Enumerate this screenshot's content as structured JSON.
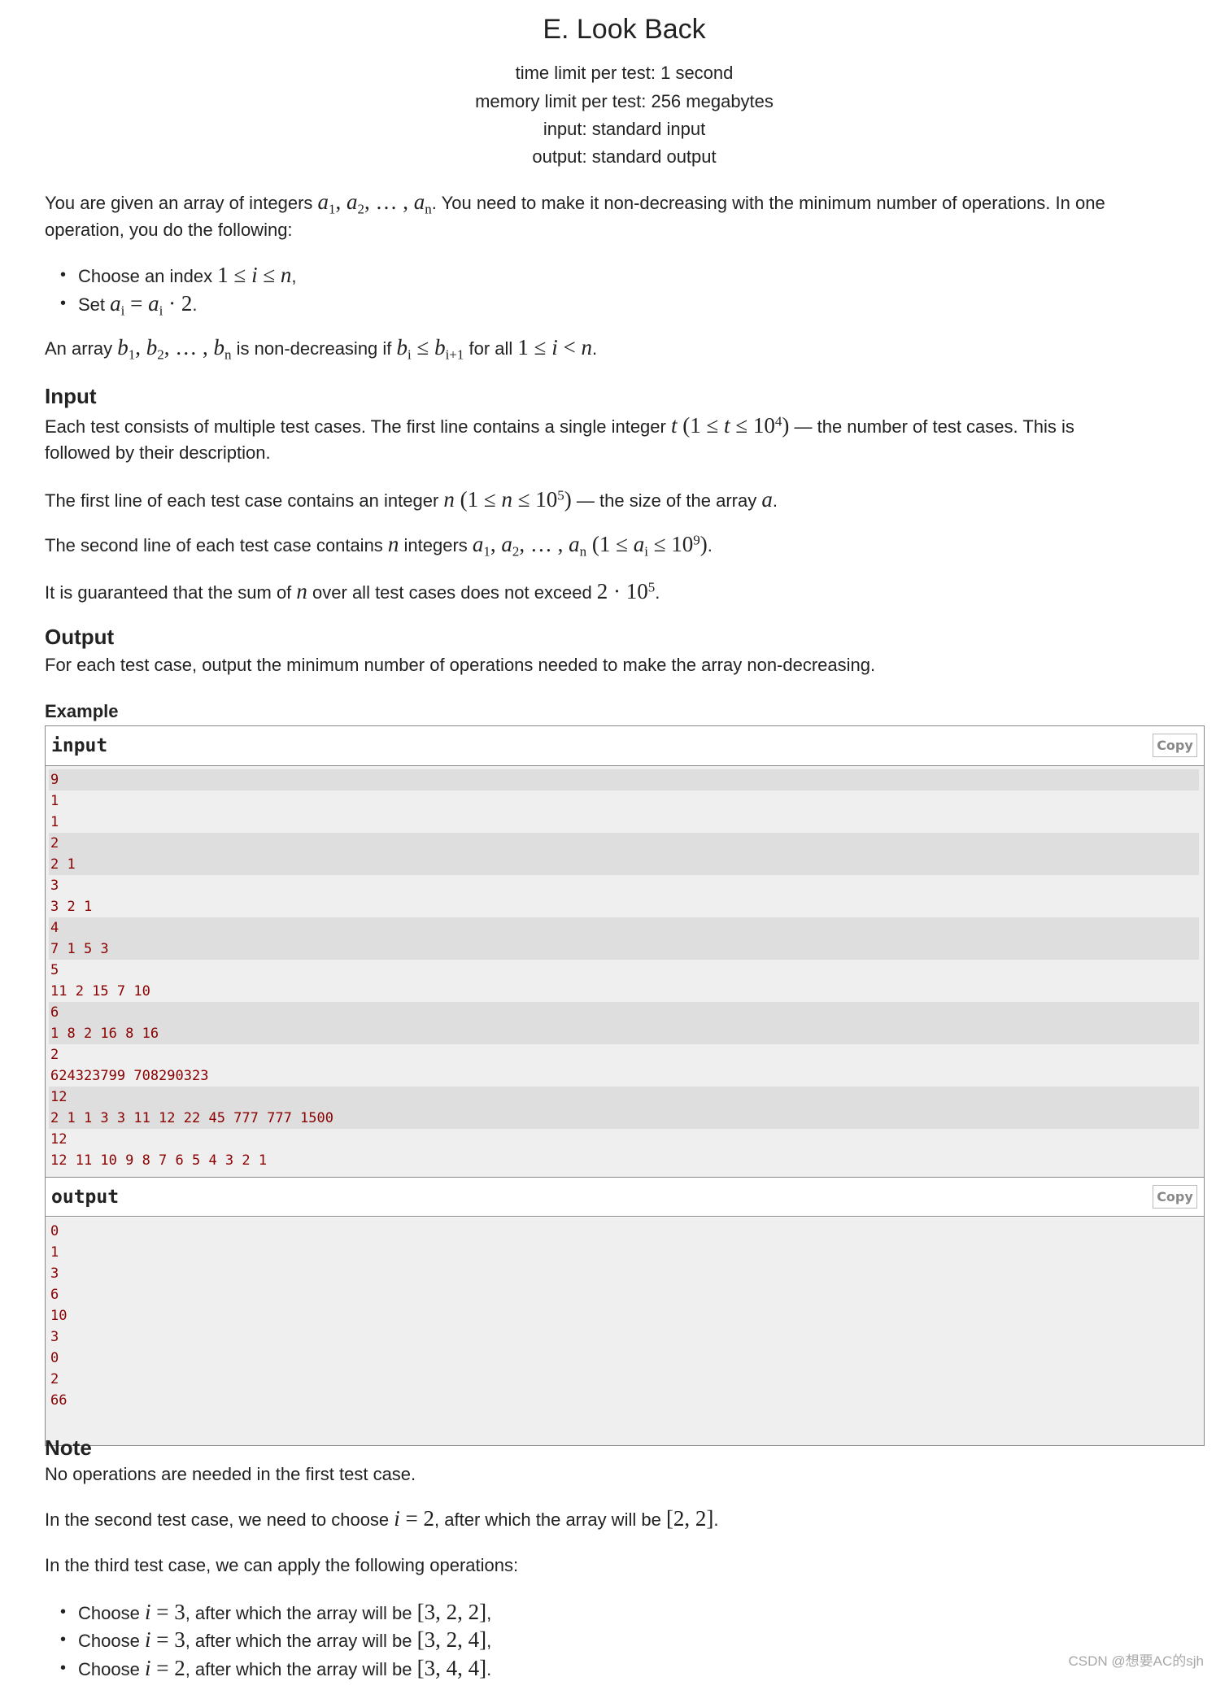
{
  "header": {
    "title": "E. Look Back",
    "time_limit": "time limit per test: 1 second",
    "memory_limit": "memory limit per test: 256 megabytes",
    "input_spec": "input: standard input",
    "output_spec": "output: standard output"
  },
  "statement": {
    "para1_line1": [
      {
        "t": "You are given an array of integers "
      },
      {
        "m": "a"
      },
      {
        "sub": "1"
      },
      {
        "r": ", "
      },
      {
        "m": "a"
      },
      {
        "sub": "2"
      },
      {
        "r": ", … , "
      },
      {
        "m": "a"
      },
      {
        "sub": "n"
      },
      {
        "t": ". You need to make it non-decreasing with the minimum number of operations. In one"
      }
    ],
    "para1_line2": "operation, you do the following:",
    "bullets": [
      [
        {
          "t": "Choose an index "
        },
        {
          "r": "1 ≤ "
        },
        {
          "m": "i"
        },
        {
          "r": " ≤ "
        },
        {
          "m": "n"
        },
        {
          "t": ","
        }
      ],
      [
        {
          "t": "Set "
        },
        {
          "m": "a"
        },
        {
          "sub": "i"
        },
        {
          "r": " = "
        },
        {
          "m": "a"
        },
        {
          "sub": "i"
        },
        {
          "r": " · 2"
        },
        {
          "t": "."
        }
      ]
    ],
    "para2": [
      {
        "t": "An array "
      },
      {
        "m": "b"
      },
      {
        "sub": "1"
      },
      {
        "r": ", "
      },
      {
        "m": "b"
      },
      {
        "sub": "2"
      },
      {
        "r": ", … , "
      },
      {
        "m": "b"
      },
      {
        "sub": "n"
      },
      {
        "t": " is non-decreasing if "
      },
      {
        "m": "b"
      },
      {
        "sub": "i"
      },
      {
        "r": " ≤ "
      },
      {
        "m": "b"
      },
      {
        "sub": "i+1"
      },
      {
        "t": " for all "
      },
      {
        "r": "1 ≤ "
      },
      {
        "m": "i"
      },
      {
        "r": " < "
      },
      {
        "m": "n"
      },
      {
        "t": "."
      }
    ]
  },
  "input_section": {
    "heading": "Input",
    "p1_line1": [
      {
        "t": "Each test consists of multiple test cases. The first line contains a single integer "
      },
      {
        "m": "t"
      },
      {
        "r": " (1 ≤ "
      },
      {
        "m": "t"
      },
      {
        "r": " ≤ 10"
      },
      {
        "sup": "4"
      },
      {
        "r": ")"
      },
      {
        "t": " — the number of test cases. This is"
      }
    ],
    "p1_line2": "followed by their description.",
    "p2": [
      {
        "t": "The first line of each test case contains an integer "
      },
      {
        "m": "n"
      },
      {
        "r": " (1 ≤ "
      },
      {
        "m": "n"
      },
      {
        "r": " ≤ 10"
      },
      {
        "sup": "5"
      },
      {
        "r": ")"
      },
      {
        "t": " — the size of the array "
      },
      {
        "m": "a"
      },
      {
        "t": "."
      }
    ],
    "p3": [
      {
        "t": "The second line of each test case contains "
      },
      {
        "m": "n"
      },
      {
        "t": " integers "
      },
      {
        "m": "a"
      },
      {
        "sub": "1"
      },
      {
        "r": ", "
      },
      {
        "m": "a"
      },
      {
        "sub": "2"
      },
      {
        "r": ", … , "
      },
      {
        "m": "a"
      },
      {
        "sub": "n"
      },
      {
        "r": " (1 ≤ "
      },
      {
        "m": "a"
      },
      {
        "sub": "i"
      },
      {
        "r": " ≤ 10"
      },
      {
        "sup": "9"
      },
      {
        "r": ")"
      },
      {
        "t": "."
      }
    ],
    "p4": [
      {
        "t": "It is guaranteed that the sum of "
      },
      {
        "m": "n"
      },
      {
        "t": " over all test cases does not exceed "
      },
      {
        "r": "2 · 10"
      },
      {
        "sup": "5"
      },
      {
        "t": "."
      }
    ]
  },
  "output_section": {
    "heading": "Output",
    "text": "For each test case, output the minimum number of operations needed to make the array non-decreasing."
  },
  "example": {
    "heading": "Example",
    "input_title": "input",
    "output_title": "output",
    "copy_label": "Copy",
    "input_lines": [
      {
        "text": "9",
        "hl": true
      },
      {
        "text": "1",
        "hl": false
      },
      {
        "text": "1",
        "hl": false
      },
      {
        "text": "2",
        "hl": true
      },
      {
        "text": "2 1",
        "hl": true
      },
      {
        "text": "3",
        "hl": false
      },
      {
        "text": "3 2 1",
        "hl": false
      },
      {
        "text": "4",
        "hl": true
      },
      {
        "text": "7 1 5 3",
        "hl": true
      },
      {
        "text": "5",
        "hl": false
      },
      {
        "text": "11 2 15 7 10",
        "hl": false
      },
      {
        "text": "6",
        "hl": true
      },
      {
        "text": "1 8 2 16 8 16",
        "hl": true
      },
      {
        "text": "2",
        "hl": false
      },
      {
        "text": "624323799 708290323",
        "hl": false
      },
      {
        "text": "12",
        "hl": true
      },
      {
        "text": "2 1 1 3 3 11 12 22 45 777 777 1500",
        "hl": true
      },
      {
        "text": "12",
        "hl": false
      },
      {
        "text": "12 11 10 9 8 7 6 5 4 3 2 1",
        "hl": false
      }
    ],
    "output_lines": [
      "0",
      "1",
      "3",
      "6",
      "10",
      "3",
      "0",
      "2",
      "66"
    ]
  },
  "note": {
    "heading": "Note",
    "p1": "No operations are needed in the first test case.",
    "p2": [
      {
        "t": "In the second test case, we need to choose "
      },
      {
        "m": "i"
      },
      {
        "r": " = 2"
      },
      {
        "t": ", after which the array will be "
      },
      {
        "r": "[2, 2]"
      },
      {
        "t": "."
      }
    ],
    "p3": "In the third test case, we can apply the following operations:",
    "bullets": [
      [
        {
          "t": "Choose "
        },
        {
          "m": "i"
        },
        {
          "r": " = 3"
        },
        {
          "t": ", after which the array will be "
        },
        {
          "r": "[3, 2, 2]"
        },
        {
          "t": ","
        }
      ],
      [
        {
          "t": "Choose "
        },
        {
          "m": "i"
        },
        {
          "r": " = 3"
        },
        {
          "t": ", after which the array will be "
        },
        {
          "r": "[3, 2, 4]"
        },
        {
          "t": ","
        }
      ],
      [
        {
          "t": "Choose "
        },
        {
          "m": "i"
        },
        {
          "r": " = 2"
        },
        {
          "t": ", after which the array will be "
        },
        {
          "r": "[3, 4, 4]"
        },
        {
          "t": "."
        }
      ]
    ]
  },
  "watermark": "CSDN @想要AC的sjh",
  "colors": {
    "sample_text": "#8b0000",
    "sample_bg": "#efefef",
    "sample_highlight": "#dedede",
    "border": "#888888"
  }
}
